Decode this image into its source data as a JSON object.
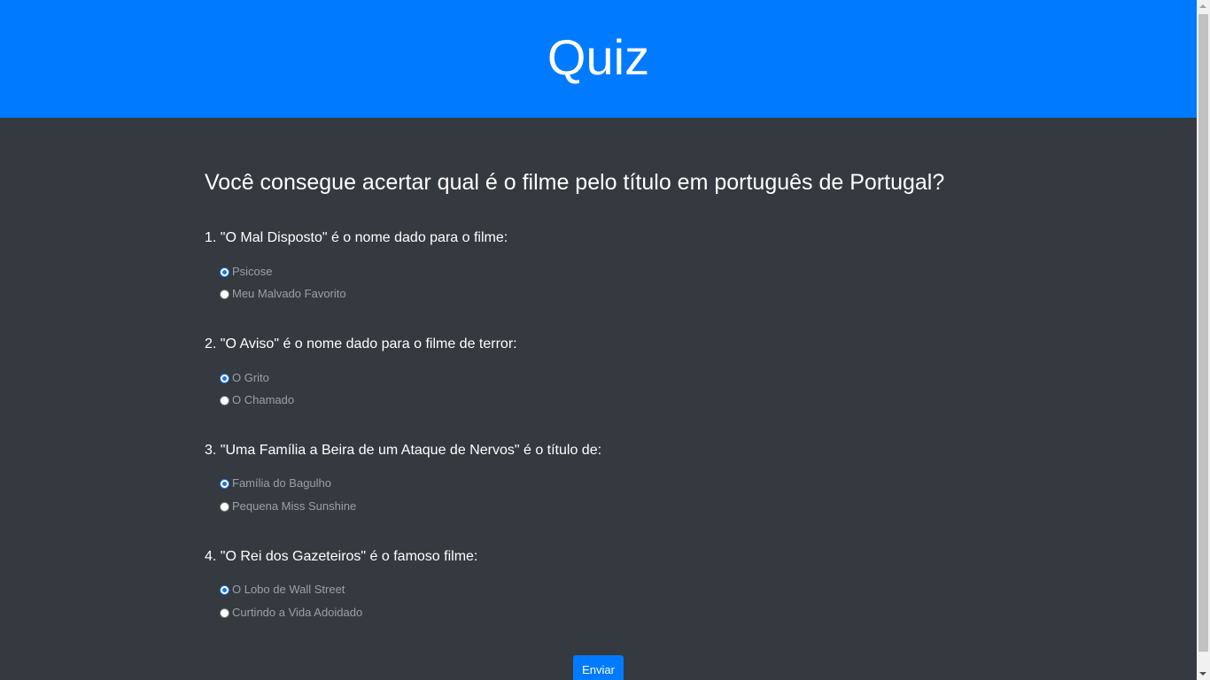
{
  "header": {
    "title": "Quiz"
  },
  "intro": "Você consegue acertar qual é o filme pelo título em português de Portugal?",
  "questions": [
    {
      "text": "1. \"O Mal Disposto\" é o nome dado para o filme:",
      "options": [
        "Psicose",
        "Meu Malvado Favorito"
      ],
      "selected": 0
    },
    {
      "text": "2. \"O Aviso\" é o nome dado para o filme de terror:",
      "options": [
        "O Grito",
        "O Chamado"
      ],
      "selected": 0
    },
    {
      "text": "3. \"Uma Família a Beira de um Ataque de Nervos\" é o título de:",
      "options": [
        "Família do Bagulho",
        "Pequena Miss Sunshine"
      ],
      "selected": 0
    },
    {
      "text": "4. \"O Rei dos Gazeteiros\" é o famoso filme:",
      "options": [
        "O Lobo de Wall Street",
        "Curtindo a Vida Adoidado"
      ],
      "selected": 0
    }
  ],
  "submit_label": "Enviar",
  "colors": {
    "header_bg": "#007bff",
    "page_bg": "#343a40",
    "option_text": "#9aa0a6"
  }
}
